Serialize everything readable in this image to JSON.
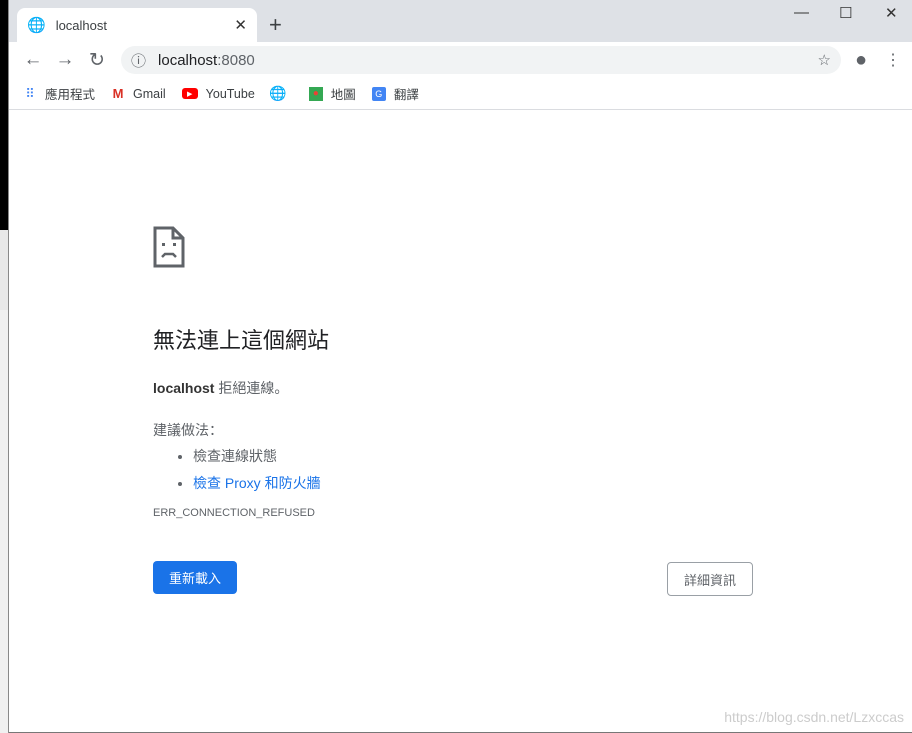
{
  "tab": {
    "title": "localhost",
    "icon": "globe-icon"
  },
  "omnibox": {
    "host": "localhost",
    "port": ":8080"
  },
  "bookmarks": [
    {
      "label": "應用程式",
      "icon": "apps-icon"
    },
    {
      "label": "Gmail",
      "icon": "gmail-icon"
    },
    {
      "label": "YouTube",
      "icon": "youtube-icon"
    },
    {
      "label": "",
      "icon": "globe-icon"
    },
    {
      "label": "地圖",
      "icon": "maps-icon"
    },
    {
      "label": "翻譯",
      "icon": "translate-icon"
    }
  ],
  "error": {
    "title": "無法連上這個網站",
    "host": "localhost",
    "message": " 拒絕連線。",
    "suggest": "建議做法：",
    "items": [
      "檢查連線狀態",
      "檢查 Proxy 和防火牆"
    ],
    "code": "ERR_CONNECTION_REFUSED"
  },
  "buttons": {
    "reload": "重新載入",
    "details": "詳細資訊"
  },
  "watermark": "https://blog.csdn.net/Lzxccas",
  "colors": {
    "accent": "#1a73e8",
    "tabbar": "#dee1e6"
  }
}
